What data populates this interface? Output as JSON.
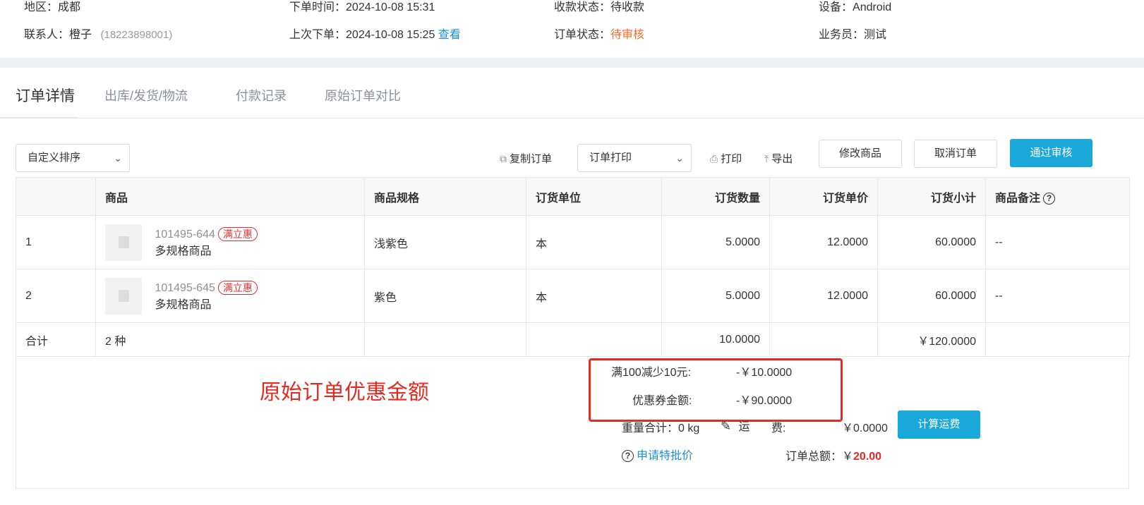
{
  "info": {
    "row1": [
      {
        "label": "地区：",
        "value": "成都"
      },
      {
        "label": "下单时间：",
        "value": "2024-10-08 15:31"
      },
      {
        "label": "收款状态：",
        "value": "待收款"
      },
      {
        "label": "设备：",
        "value": "Android"
      }
    ],
    "contact_label": "联系人：",
    "contact_name": "橙子",
    "contact_phone": "(18223898001)",
    "last_order_label": "上次下单：",
    "last_order_time": "2024-10-08 15:25",
    "last_order_link": "查看",
    "order_status_label": "订单状态：",
    "order_status": "待审核",
    "salesman_label": "业务员：",
    "salesman": "测试"
  },
  "tabs": [
    "订单详情",
    "出库/发货/物流",
    "付款记录",
    "原始订单对比"
  ],
  "toolbar": {
    "sort_select": "自定义排序",
    "copy_order": "复制订单",
    "print_select": "订单打印",
    "print": "打印",
    "export": "导出",
    "modify_goods": "修改商品",
    "cancel_order": "取消订单",
    "approve": "通过审核"
  },
  "table": {
    "headers": [
      "",
      "商品",
      "商品规格",
      "订货单位",
      "订货数量",
      "订货单价",
      "订货小计",
      "商品备注"
    ],
    "rows": [
      {
        "index": "1",
        "code": "101495-644",
        "tag": "满立惠",
        "name": "多规格商品",
        "spec": "浅紫色",
        "unit": "本",
        "qty": "5.0000",
        "price": "12.0000",
        "subtotal": "60.0000",
        "remark": "--"
      },
      {
        "index": "2",
        "code": "101495-645",
        "tag": "满立惠",
        "name": "多规格商品",
        "spec": "紫色",
        "unit": "本",
        "qty": "5.0000",
        "price": "12.0000",
        "subtotal": "60.0000",
        "remark": "--"
      }
    ],
    "total": {
      "label": "合计",
      "kinds": "2 种",
      "qty": "10.0000",
      "subtotal": "￥120.0000"
    }
  },
  "summary": {
    "annotation": "原始订单优惠金额",
    "discount_label": "满100减少10元:",
    "discount_value": "-￥10.0000",
    "coupon_label": "优惠券金额:",
    "coupon_value": "-￥90.0000",
    "weight_label": "重量合计：",
    "weight_value": "0 kg",
    "freight_label_a": "运",
    "freight_label_b": "费:",
    "freight_value": "￥0.0000",
    "calc_freight": "计算运费",
    "special_price": "申请特批价",
    "total_label": "订单总额：",
    "total_currency": "￥",
    "total_value": "20.00"
  }
}
